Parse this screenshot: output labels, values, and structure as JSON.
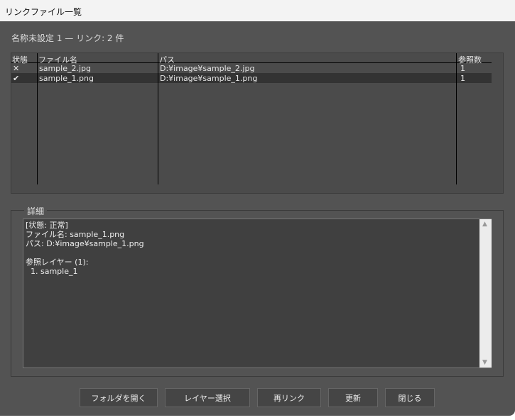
{
  "window": {
    "title": "リンクファイル一覧"
  },
  "summary": "名称未設定 1 — リンク: 2 件",
  "table": {
    "headers": [
      "状態",
      "ファイル名",
      "パス",
      "参照数"
    ],
    "rows": [
      {
        "status_icon": "✕",
        "status": "error-icon",
        "file": "sample_2.jpg",
        "path": "D:¥image¥sample_2.jpg",
        "refs": "1"
      },
      {
        "status_icon": "✔",
        "status": "check-icon",
        "file": "sample_1.png",
        "path": "D:¥image¥sample_1.png",
        "refs": "1",
        "selected": true
      }
    ]
  },
  "details": {
    "label": "詳細",
    "text": "[状態: 正常]\nファイル名: sample_1.png\nパス: D:¥image¥sample_1.png\n\n参照レイヤー (1):\n  1. sample_1"
  },
  "buttons": {
    "open_folder": "フォルダを開く",
    "select_layer": "レイヤー選択",
    "relink": "再リンク",
    "update": "更新",
    "close": "閉じる"
  }
}
